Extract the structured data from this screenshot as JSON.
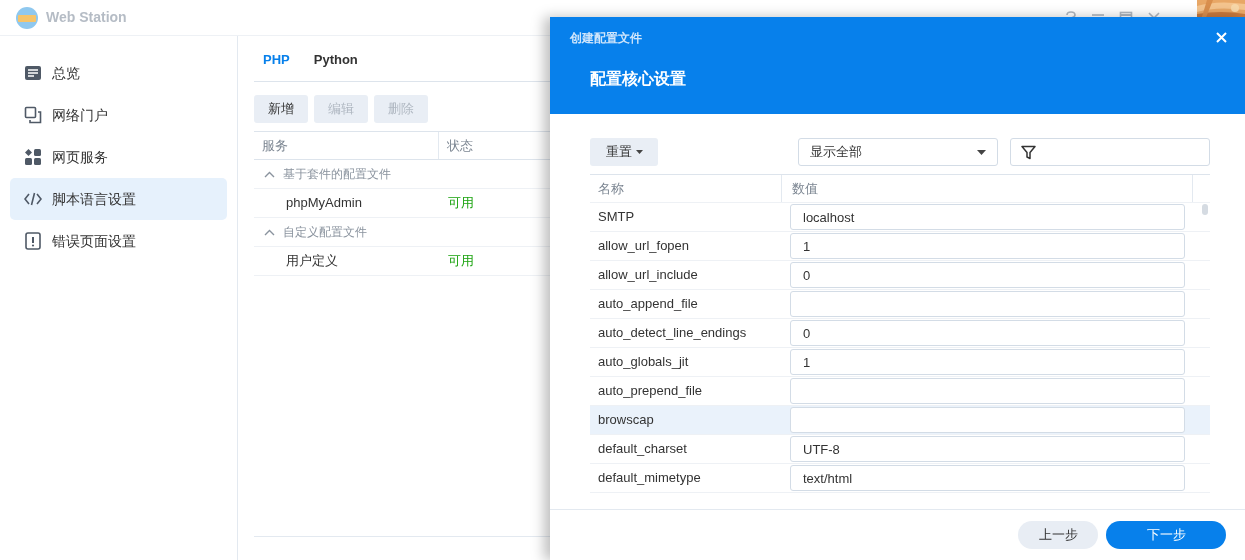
{
  "window": {
    "title": "Web Station"
  },
  "sidebar": {
    "items": [
      {
        "label": "总览",
        "selected": false
      },
      {
        "label": "网络门户",
        "selected": false
      },
      {
        "label": "网页服务",
        "selected": false
      },
      {
        "label": "脚本语言设置",
        "selected": true
      },
      {
        "label": "错误页面设置",
        "selected": false
      }
    ]
  },
  "tabs": [
    {
      "label": "PHP",
      "selected": true
    },
    {
      "label": "Python",
      "selected": false
    }
  ],
  "toolbar": [
    {
      "label": "新增",
      "disabled": false
    },
    {
      "label": "编辑",
      "disabled": true
    },
    {
      "label": "删除",
      "disabled": true
    }
  ],
  "table": {
    "columns": [
      "服务",
      "状态"
    ],
    "groups": [
      {
        "label": "基于套件的配置文件",
        "expanded": true,
        "rows": [
          {
            "service": "phpMyAdmin",
            "status": "可用"
          }
        ]
      },
      {
        "label": "自定义配置文件",
        "expanded": true,
        "rows": [
          {
            "service": "用户定义",
            "status": "可用"
          }
        ]
      }
    ]
  },
  "dialog": {
    "title": "创建配置文件",
    "heading": "配置核心设置",
    "reset_button": "重置",
    "filter_select": "显示全部",
    "columns": [
      "名称",
      "数值"
    ],
    "rows": [
      {
        "name": "SMTP",
        "value": "localhost",
        "selected": false
      },
      {
        "name": "allow_url_fopen",
        "value": "1",
        "selected": false
      },
      {
        "name": "allow_url_include",
        "value": "0",
        "selected": false
      },
      {
        "name": "auto_append_file",
        "selected": false
      },
      {
        "name": "auto_detect_line_endings",
        "value": "0",
        "selected": false
      },
      {
        "name": "auto_globals_jit",
        "value": "1",
        "selected": false
      },
      {
        "name": "auto_prepend_file",
        "selected": false
      },
      {
        "name": "browscap",
        "selected": true
      },
      {
        "name": "default_charset",
        "value": "UTF-8",
        "selected": false
      },
      {
        "name": "default_mimetype",
        "value": "text/html",
        "selected": false
      }
    ],
    "back_button": "上一步",
    "next_button": "下一步"
  }
}
